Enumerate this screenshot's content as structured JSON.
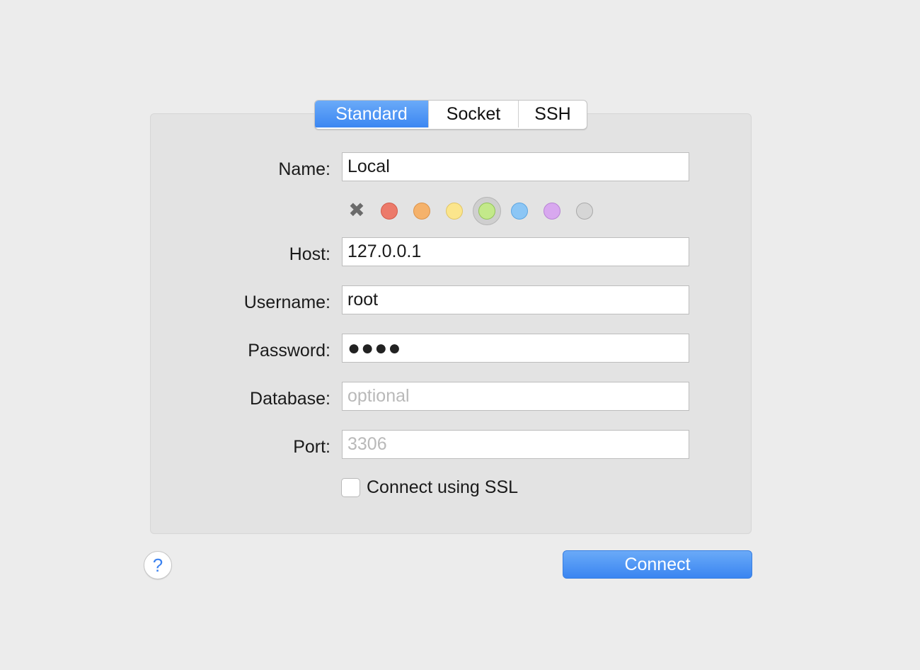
{
  "tabs": [
    {
      "label": "Standard",
      "active": true
    },
    {
      "label": "Socket",
      "active": false
    },
    {
      "label": "SSH",
      "active": false
    }
  ],
  "form": {
    "name": {
      "label": "Name:",
      "value": "Local"
    },
    "host": {
      "label": "Host:",
      "value": "127.0.0.1"
    },
    "username": {
      "label": "Username:",
      "value": "root"
    },
    "password": {
      "label": "Password:",
      "value": "●●●●"
    },
    "database": {
      "label": "Database:",
      "value": "",
      "placeholder": "optional"
    },
    "port": {
      "label": "Port:",
      "value": "",
      "placeholder": "3306"
    }
  },
  "color_picker": {
    "clear_icon": "close-icon",
    "swatches": [
      {
        "name": "red",
        "fill": "#ec7a6a",
        "stroke": "#d25c4c"
      },
      {
        "name": "orange",
        "fill": "#f5b26b",
        "stroke": "#dc934a"
      },
      {
        "name": "yellow",
        "fill": "#fbe58c",
        "stroke": "#e0c566"
      },
      {
        "name": "green",
        "fill": "#c3e98a",
        "stroke": "#92c45a"
      },
      {
        "name": "blue",
        "fill": "#8cc6f5",
        "stroke": "#5ea6e0"
      },
      {
        "name": "purple",
        "fill": "#d8a8ef",
        "stroke": "#b784d4"
      },
      {
        "name": "gray",
        "fill": "#d6d6d6",
        "stroke": "#a9a9a9"
      }
    ],
    "selected": "green"
  },
  "ssl": {
    "label": "Connect using SSL",
    "checked": false
  },
  "help_button": {
    "label": "?"
  },
  "connect_button": {
    "label": "Connect"
  },
  "colors": {
    "accent": "#3c87f2",
    "background": "#ececec",
    "panel": "#e3e3e3"
  }
}
